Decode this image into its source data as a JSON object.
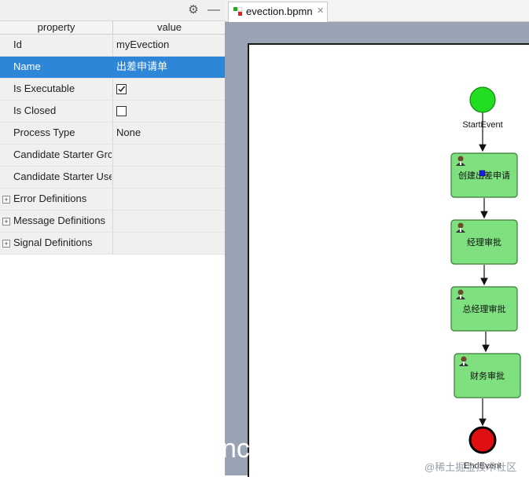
{
  "properties": {
    "header": {
      "property": "property",
      "value": "value"
    },
    "rows": [
      {
        "key": "Id",
        "value": "myEvection"
      },
      {
        "key": "Name",
        "value": "出差申请单"
      },
      {
        "key": "Is Executable",
        "value": ""
      },
      {
        "key": "Is Closed",
        "value": ""
      },
      {
        "key": "Process Type",
        "value": "None"
      },
      {
        "key": "Candidate Starter Grc",
        "value": ""
      },
      {
        "key": "Candidate Starter Use",
        "value": ""
      },
      {
        "key": "Error Definitions",
        "value": ""
      },
      {
        "key": "Message Definitions",
        "value": ""
      },
      {
        "key": "Signal Definitions",
        "value": ""
      }
    ],
    "is_executable_checked": true,
    "is_closed_checked": false,
    "selected_row": "Name"
  },
  "toolbar": {
    "gear_icon": "gear-icon",
    "minimize_icon": "minimize-icon"
  },
  "editor": {
    "tab_label": "evection.bpmn",
    "tab_close": "✕"
  },
  "diagram": {
    "start_label": "StartEvent",
    "end_label": "EndEvent",
    "tasks": [
      "创建出差申请",
      "经理审批",
      "总经理审批",
      "财务审批"
    ],
    "colors": {
      "task_fill": "#7ee07e",
      "task_stroke": "#3a7a3a",
      "start_fill": "#22dd22",
      "end_fill": "#e01010"
    }
  },
  "watermark": "@稀土掘金技术社区",
  "watermark_text": "nc"
}
